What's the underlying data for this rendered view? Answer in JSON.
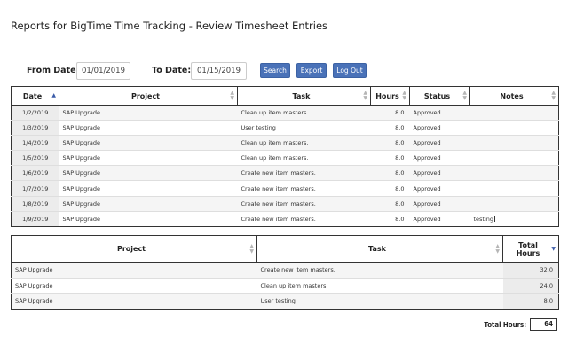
{
  "page": {
    "title": "Reports for BigTime Time Tracking - Review Timesheet Entries"
  },
  "filters": {
    "from_label": "From Date:",
    "from_value": "01/01/2019",
    "to_label": "To Date:",
    "to_value": "01/15/2019",
    "search_label": "Search",
    "export_label": "Export",
    "logout_label": "Log Out"
  },
  "colors": {
    "button": "#4a72b8",
    "sort_active": "#3a5ba8",
    "row_alt": "#f5f5f5",
    "border": "#333333"
  },
  "entries": {
    "headers": {
      "date": "Date",
      "project": "Project",
      "task": "Task",
      "hours": "Hours",
      "status": "Status",
      "notes": "Notes"
    },
    "sorted_by": "date",
    "rows": [
      {
        "date": "1/2/2019",
        "project": "SAP Upgrade",
        "task": "Clean up item masters.",
        "hours": "8.0",
        "status": "Approved",
        "notes": ""
      },
      {
        "date": "1/3/2019",
        "project": "SAP Upgrade",
        "task": "User testing",
        "hours": "8.0",
        "status": "Approved",
        "notes": ""
      },
      {
        "date": "1/4/2019",
        "project": "SAP Upgrade",
        "task": "Clean up item masters.",
        "hours": "8.0",
        "status": "Approved",
        "notes": ""
      },
      {
        "date": "1/5/2019",
        "project": "SAP Upgrade",
        "task": "Clean up item masters.",
        "hours": "8.0",
        "status": "Approved",
        "notes": ""
      },
      {
        "date": "1/6/2019",
        "project": "SAP Upgrade",
        "task": "Create new item masters.",
        "hours": "8.0",
        "status": "Approved",
        "notes": ""
      },
      {
        "date": "1/7/2019",
        "project": "SAP Upgrade",
        "task": "Create new item masters.",
        "hours": "8.0",
        "status": "Approved",
        "notes": ""
      },
      {
        "date": "1/8/2019",
        "project": "SAP Upgrade",
        "task": "Create new item masters.",
        "hours": "8.0",
        "status": "Approved",
        "notes": ""
      },
      {
        "date": "1/9/2019",
        "project": "SAP Upgrade",
        "task": "Create new item masters.",
        "hours": "8.0",
        "status": "Approved",
        "notes": "testing"
      }
    ]
  },
  "totals": {
    "headers": {
      "project": "Project",
      "task": "Task",
      "total_hours": "Total Hours"
    },
    "sorted_by": "total_hours",
    "rows": [
      {
        "project": "SAP Upgrade",
        "task": "Create new item masters.",
        "total": "32.0"
      },
      {
        "project": "SAP Upgrade",
        "task": "Clean up item masters.",
        "total": "24.0"
      },
      {
        "project": "SAP Upgrade",
        "task": "User testing",
        "total": "8.0"
      }
    ],
    "grand_label": "Total Hours:",
    "grand_value": "64"
  }
}
